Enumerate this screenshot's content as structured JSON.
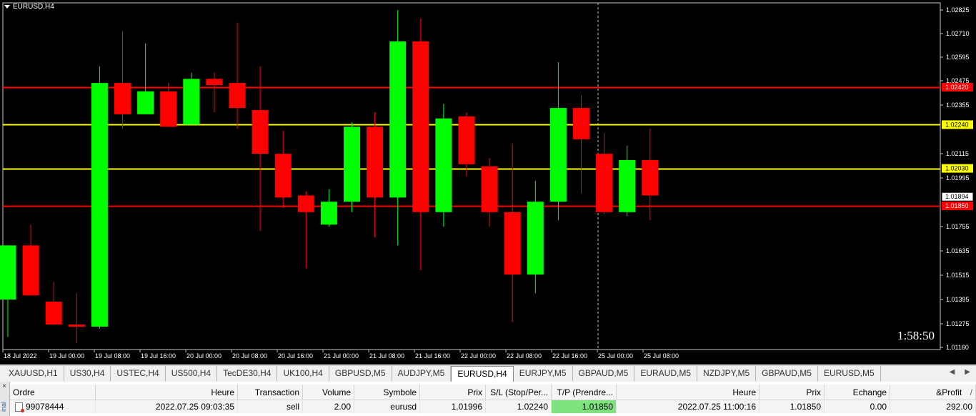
{
  "chart": {
    "title": "EURUSD,H4",
    "timer": "1:58:50",
    "price_axis": [
      "1.02825",
      "1.02710",
      "1.02595",
      "1.02475",
      "1.02355",
      "1.02115",
      "1.01995",
      "1.01755",
      "1.01635",
      "1.01515",
      "1.01395",
      "1.01275",
      "1.01160"
    ],
    "time_axis": [
      "18 Jul 2022",
      "19 Jul 00:00",
      "19 Jul 08:00",
      "19 Jul 16:00",
      "20 Jul 00:00",
      "20 Jul 08:00",
      "20 Jul 16:00",
      "21 Jul 00:00",
      "21 Jul 08:00",
      "21 Jul 16:00",
      "22 Jul 00:00",
      "22 Jul 08:00",
      "22 Jul 16:00",
      "25 Jul 00:00",
      "25 Jul 08:00"
    ],
    "horizontal_lines": [
      {
        "price": 1.0242,
        "label": "1.02420",
        "color": "#ff0000",
        "label_text_color": "#ffffff"
      },
      {
        "price": 1.0224,
        "label": "1.02240",
        "color": "#ffff00",
        "label_text_color": "#000000"
      },
      {
        "price": 1.0203,
        "label": "1.02030",
        "color": "#ffff00",
        "label_text_color": "#000000"
      },
      {
        "price": 1.0185,
        "label": "1.01850",
        "color": "#ff0000",
        "label_text_color": "#ffffff"
      }
    ],
    "current_price": {
      "price": 1.01894,
      "label": "1.01894"
    },
    "colors": {
      "bull": "#00ff00",
      "bear": "#ff0000",
      "background": "#000000",
      "axis_text": "#ffffff"
    },
    "candles": [
      {
        "o": 1.014,
        "h": 1.0166,
        "l": 1.0122,
        "c": 1.0166
      },
      {
        "o": 1.0166,
        "h": 1.0176,
        "l": 1.0142,
        "c": 1.0142
      },
      {
        "o": 1.0139,
        "h": 1.01485,
        "l": 1.0128,
        "c": 1.0128
      },
      {
        "o": 1.0128,
        "h": 1.0143,
        "l": 1.0119,
        "c": 1.0127
      },
      {
        "o": 1.0127,
        "h": 1.0252,
        "l": 1.0126,
        "c": 1.0244
      },
      {
        "o": 1.0244,
        "h": 1.0269,
        "l": 1.0222,
        "c": 1.0229
      },
      {
        "o": 1.0229,
        "h": 1.0263,
        "l": 1.0229,
        "c": 1.024
      },
      {
        "o": 1.024,
        "h": 1.0244,
        "l": 1.0223,
        "c": 1.0223
      },
      {
        "o": 1.0224,
        "h": 1.0249,
        "l": 1.0224,
        "c": 1.0246
      },
      {
        "o": 1.0246,
        "h": 1.0249,
        "l": 1.023,
        "c": 1.0243
      },
      {
        "o": 1.0244,
        "h": 1.0273,
        "l": 1.0222,
        "c": 1.0232
      },
      {
        "o": 1.0231,
        "h": 1.0252,
        "l": 1.0173,
        "c": 1.021
      },
      {
        "o": 1.021,
        "h": 1.0221,
        "l": 1.0184,
        "c": 1.0189
      },
      {
        "o": 1.019,
        "h": 1.0192,
        "l": 1.0155,
        "c": 1.0182
      },
      {
        "o": 1.0176,
        "h": 1.0193,
        "l": 1.0175,
        "c": 1.0187
      },
      {
        "o": 1.0187,
        "h": 1.0225,
        "l": 1.0182,
        "c": 1.0223
      },
      {
        "o": 1.0223,
        "h": 1.023,
        "l": 1.017,
        "c": 1.0189
      },
      {
        "o": 1.0189,
        "h": 1.0279,
        "l": 1.0166,
        "c": 1.0264
      },
      {
        "o": 1.0264,
        "h": 1.0275,
        "l": 1.0154,
        "c": 1.0182
      },
      {
        "o": 1.0182,
        "h": 1.0234,
        "l": 1.0175,
        "c": 1.0227
      },
      {
        "o": 1.0228,
        "h": 1.023,
        "l": 1.0199,
        "c": 1.0205
      },
      {
        "o": 1.0204,
        "h": 1.0208,
        "l": 1.0175,
        "c": 1.0182
      },
      {
        "o": 1.0182,
        "h": 1.0215,
        "l": 1.0129,
        "c": 1.0152
      },
      {
        "o": 1.0152,
        "h": 1.0197,
        "l": 1.0143,
        "c": 1.0187
      },
      {
        "o": 1.0187,
        "h": 1.0254,
        "l": 1.0178,
        "c": 1.0232
      },
      {
        "o": 1.0232,
        "h": 1.0238,
        "l": 1.0191,
        "c": 1.0217
      },
      {
        "o": 1.021,
        "h": 1.022,
        "l": 1.0181,
        "c": 1.0182
      },
      {
        "o": 1.0182,
        "h": 1.0214,
        "l": 1.018,
        "c": 1.0207
      },
      {
        "o": 1.0207,
        "h": 1.0222,
        "l": 1.0178,
        "c": 1.019
      }
    ]
  },
  "tabs": [
    "XAUUSD,H1",
    "US30,H4",
    "USTEC,H4",
    "US500,H4",
    "TecDE30,H4",
    "UK100,H4",
    "GBPUSD,M5",
    "AUDJPY,M5",
    "EURUSD,H4",
    "EURJPY,M5",
    "GBPAUD,M5",
    "EURAUD,M5",
    "NZDJPY,M5",
    "GBPAUD,M5",
    "EURUSD,M5"
  ],
  "active_tab": "EURUSD,H4",
  "terminal": {
    "close": "×",
    "side_label": "inal",
    "headers": [
      "Ordre",
      "Heure",
      "Transaction",
      "Volume",
      "Symbole",
      "Prix",
      "S/L (Stop/Per...",
      "T/P (Prendre...",
      "Heure",
      "Prix",
      "Echange",
      "&Profit"
    ],
    "sort_marker": "/",
    "row": {
      "order": "99078444",
      "time": "2022.07.25 09:03:35",
      "type": "sell",
      "volume": "2.00",
      "symbol": "eurusd",
      "price": "1.01996",
      "sl": "1.02240",
      "tp": "1.01850",
      "time2": "2022.07.25 11:00:16",
      "price2": "1.01850",
      "swap": "0.00",
      "profit": "292.00"
    }
  }
}
